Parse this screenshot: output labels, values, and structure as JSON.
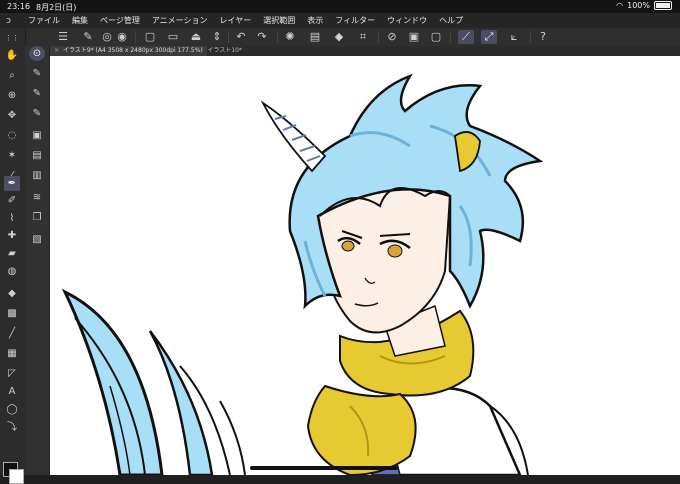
{
  "status": {
    "time": "23:16",
    "date": "8月2日(日)",
    "battery": "100%"
  },
  "menu": {
    "items": [
      "ファイル",
      "編集",
      "ページ管理",
      "アニメーション",
      "レイヤー",
      "選択範囲",
      "表示",
      "フィルター",
      "ウィンドウ",
      "ヘルプ"
    ]
  },
  "tabs": [
    {
      "label": "イラスト9* (A4 3508 x 2480px 300dpi 177.5%)",
      "close": "×"
    },
    {
      "label": "イラスト10*",
      "close": "•"
    }
  ],
  "colors": {
    "hair": "#a9dff6",
    "hair_shadow": "#6fb2d8",
    "scarf": "#e7c931",
    "skin": "#fbefe6",
    "eye": "#d9a23a",
    "accent": "#4c4e66"
  },
  "icons": {
    "toolbar": [
      "menu-icon",
      "brush-icon",
      "target-icon",
      "new-file-icon",
      "open-folder-icon",
      "save-icon",
      "stepper-icon",
      "undo-icon",
      "redo-icon",
      "transform-icon",
      "layer-icon",
      "fill-icon",
      "crop-icon",
      "clear-icon",
      "snap-icon",
      "ruler-icon",
      "stabilizer-icon",
      "help-icon"
    ],
    "tools": [
      "zoom-icon",
      "hand-icon",
      "search-icon",
      "move-icon",
      "lasso-icon",
      "magic-wand-icon",
      "eyedropper-icon",
      "pen-icon",
      "brush-icon",
      "airbrush-icon",
      "decorate-icon",
      "eraser-icon",
      "blend-icon",
      "fill-icon",
      "gradient-icon",
      "line-icon",
      "frame-icon",
      "shape-icon",
      "text-icon",
      "balloon-icon",
      "correct-icon"
    ]
  }
}
